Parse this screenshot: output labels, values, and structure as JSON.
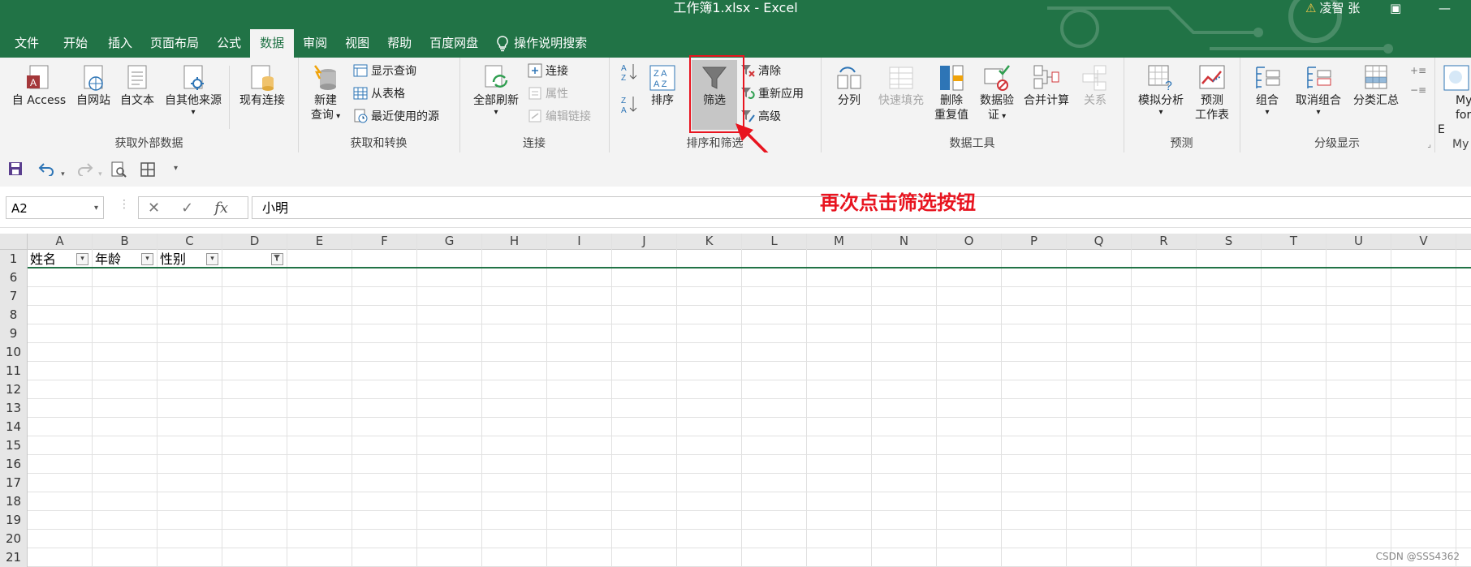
{
  "window": {
    "title": "工作簿1.xlsx  -  Excel",
    "user_name": "凌智 张",
    "warning_icon": "warning-icon"
  },
  "ribbon_tabs": [
    {
      "label": "文件",
      "active": false
    },
    {
      "label": "开始",
      "active": false
    },
    {
      "label": "插入",
      "active": false
    },
    {
      "label": "页面布局",
      "active": false
    },
    {
      "label": "公式",
      "active": false
    },
    {
      "label": "数据",
      "active": true
    },
    {
      "label": "审阅",
      "active": false
    },
    {
      "label": "视图",
      "active": false
    },
    {
      "label": "帮助",
      "active": false
    },
    {
      "label": "百度网盘",
      "active": false
    }
  ],
  "tell_me": {
    "label": "操作说明搜索",
    "icon": "lightbulb-icon"
  },
  "groups": {
    "get_external": {
      "label": "获取外部数据",
      "buttons": [
        "自 Access",
        "自网站",
        "自文本",
        "自其他来源",
        "现有连接"
      ]
    },
    "get_transform": {
      "label": "获取和转换",
      "new_query": [
        "新建",
        "查询"
      ],
      "small": [
        "显示查询",
        "从表格",
        "最近使用的源"
      ]
    },
    "connections": {
      "label": "连接",
      "refresh_all": "全部刷新",
      "small": [
        "连接",
        "属性",
        "编辑链接"
      ]
    },
    "sort_filter": {
      "label": "排序和筛选",
      "sort": "排序",
      "filter": "筛选",
      "small": [
        "清除",
        "重新应用",
        "高级"
      ]
    },
    "data_tools": {
      "label": "数据工具",
      "buttons": [
        "分列",
        "快速填充",
        "删除",
        "重复值",
        "数据验",
        "证",
        "合并计算",
        "关系"
      ]
    },
    "forecast": {
      "label": "预测",
      "buttons": [
        "模拟分析",
        "预测",
        "工作表"
      ]
    },
    "outline": {
      "label": "分级显示",
      "buttons": [
        "组合",
        "取消组合",
        "分类汇总"
      ]
    },
    "my": {
      "labels": [
        "My",
        "for E",
        "My"
      ]
    }
  },
  "formula_bar": {
    "name_box": "A2",
    "fx": "fx",
    "value": "小明"
  },
  "annotation": {
    "text": "再次点击筛选按钮",
    "color": "#e8141f"
  },
  "columns": [
    "A",
    "B",
    "C",
    "D",
    "E",
    "F",
    "G",
    "H",
    "I",
    "J",
    "K",
    "L",
    "M",
    "N",
    "O",
    "P",
    "Q",
    "R",
    "S",
    "T",
    "U",
    "V"
  ],
  "header_row": {
    "row_number": "1",
    "cells": [
      "姓名",
      "年龄",
      "性别",
      ""
    ]
  },
  "visible_rows": [
    "6",
    "7",
    "8",
    "9",
    "10",
    "11",
    "12",
    "13",
    "14",
    "15",
    "16",
    "17",
    "18",
    "19",
    "20",
    "21"
  ],
  "watermark": "CSDN @SSS4362",
  "colors": {
    "excel_green": "#217346",
    "ribbon_bg": "#f3f3f3",
    "highlight_red": "#e8141f"
  }
}
